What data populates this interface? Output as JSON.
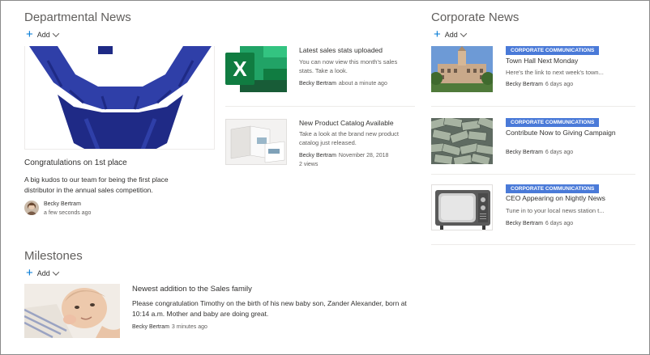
{
  "departmental": {
    "title": "Departmental News",
    "add_label": "Add",
    "hero": {
      "title": "Congratulations on 1st place",
      "description": "A big kudos to our team for being the first place distributor in the annual sales competition.",
      "author": "Becky Bertram",
      "time": "a few seconds ago"
    },
    "items": [
      {
        "title": "Latest sales stats uploaded",
        "description": "You can now view this month's sales stats. Take a look.",
        "author": "Becky Bertram",
        "time": "about a minute ago",
        "thumb_icon": "excel-icon",
        "views": ""
      },
      {
        "title": "New Product Catalog Available",
        "description": "Take a look at the brand new product catalog just released.",
        "author": "Becky Bertram",
        "time": "November 28, 2018",
        "thumb_icon": "catalog-image",
        "views": "2 views"
      }
    ]
  },
  "corporate": {
    "title": "Corporate News",
    "add_label": "Add",
    "badge_color": "#4a7ad8",
    "items": [
      {
        "badge": "CORPORATE COMMUNICATIONS",
        "title": "Town Hall Next Monday",
        "description": "Here's the link to next week's town...",
        "author": "Becky Bertram",
        "time": "6 days ago"
      },
      {
        "badge": "CORPORATE COMMUNICATIONS",
        "title": "Contribute Now to Giving Campaign",
        "description": "",
        "author": "Becky Bertram",
        "time": "6 days ago"
      },
      {
        "badge": "CORPORATE COMMUNICATIONS",
        "title": "CEO Appearing on Nightly News",
        "description": "Tune in to your local news station t...",
        "author": "Becky Bertram",
        "time": "6 days ago"
      }
    ]
  },
  "milestones": {
    "title": "Milestones",
    "add_label": "Add",
    "item": {
      "title": "Newest addition to the Sales family",
      "description": "Please congratulation Timothy on the birth of his new baby son, Zander Alexander, born at 10:14 a.m. Mother and baby are doing great.",
      "author": "Becky Bertram",
      "time": "3 minutes ago"
    }
  }
}
